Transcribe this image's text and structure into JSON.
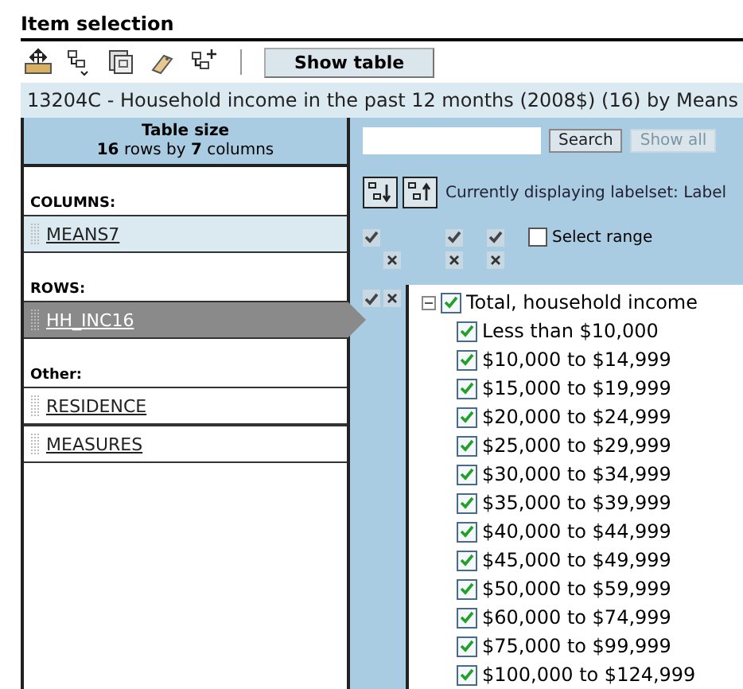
{
  "title": "Item selection",
  "toolbar": {
    "button": "Show table"
  },
  "table_title": "13204C - Household income in the past 12 months (2008$) (16) by Means",
  "table_size": {
    "heading": "Table size",
    "summary": "**16** rows by **7** columns"
  },
  "groups": [
    {
      "label": "COLUMNS:",
      "items": [
        {
          "name": "MEANS7",
          "selected": false,
          "highlighted": true
        }
      ]
    },
    {
      "label": "ROWS:",
      "items": [
        {
          "name": "HH_INC16",
          "selected": true,
          "highlighted": false
        }
      ]
    },
    {
      "label": "Other:",
      "items": [
        {
          "name": "RESIDENCE",
          "selected": false,
          "highlighted": false
        },
        {
          "name": "MEASURES",
          "selected": false,
          "highlighted": false
        }
      ]
    }
  ],
  "search": {
    "button": "Search",
    "show_all": "Show all",
    "show_all_disabled": true
  },
  "labelset": "Currently displaying labelset: Label",
  "select_range": {
    "label": "Select range",
    "checked": false
  },
  "tree": {
    "label": "Total, household income",
    "checked": true,
    "expanded": true,
    "children": [
      {
        "label": "Less than $10,000",
        "checked": true
      },
      {
        "label": "$10,000 to $14,999",
        "checked": true
      },
      {
        "label": "$15,000 to $19,999",
        "checked": true
      },
      {
        "label": "$20,000 to $24,999",
        "checked": true
      },
      {
        "label": "$25,000 to $29,999",
        "checked": true
      },
      {
        "label": "$30,000 to $34,999",
        "checked": true
      },
      {
        "label": "$35,000 to $39,999",
        "checked": true
      },
      {
        "label": "$40,000 to $44,999",
        "checked": true
      },
      {
        "label": "$45,000 to $49,999",
        "checked": true
      },
      {
        "label": "$50,000 to $59,999",
        "checked": true
      },
      {
        "label": "$60,000 to $74,999",
        "checked": true
      },
      {
        "label": "$75,000 to $99,999",
        "checked": true
      },
      {
        "label": "$100,000 to $124,999",
        "checked": true
      }
    ]
  }
}
